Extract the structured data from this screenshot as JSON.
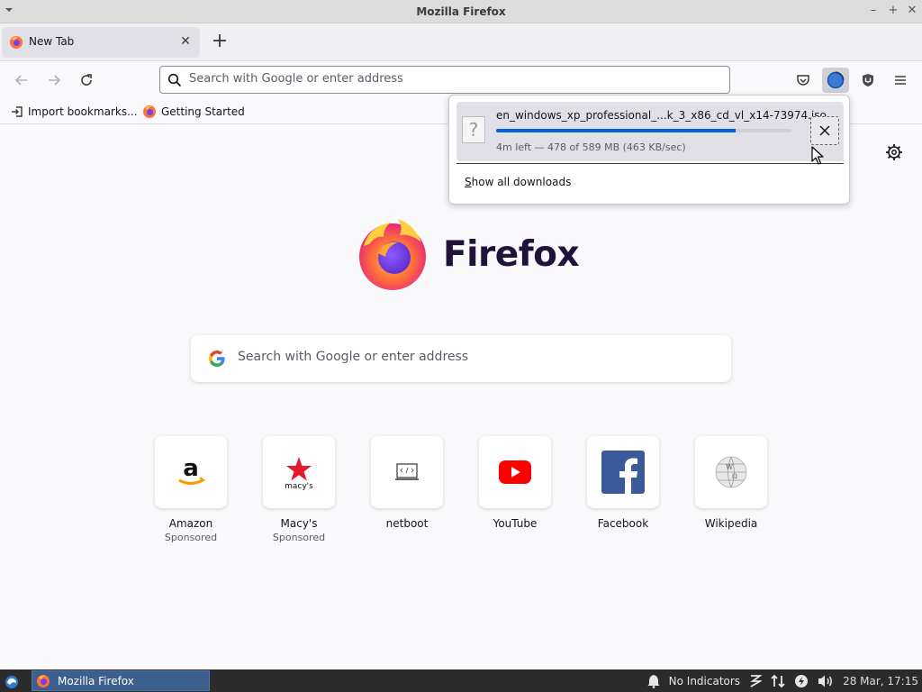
{
  "window": {
    "title": "Mozilla Firefox"
  },
  "tabs": [
    {
      "label": "New Tab",
      "active": true
    }
  ],
  "urlbar": {
    "placeholder": "Search with Google or enter address"
  },
  "bookmarks": [
    {
      "label": "Import bookmarks...",
      "icon": "import-icon"
    },
    {
      "label": "Getting Started",
      "icon": "firefox-icon"
    }
  ],
  "downloads": {
    "filename": "en_windows_xp_professional_...k_3_x86_cd_vl_x14-73974.iso",
    "status": "4m left — 478 of 589 MB (463 KB/sec)",
    "progress": 0.81,
    "show_all": "Show all downloads",
    "show_all_accesskey": "S",
    "show_all_rest": "how all downloads"
  },
  "newtab": {
    "logo_text": "Firefox",
    "search_placeholder": "Search with Google or enter address",
    "top_sites": [
      {
        "name": "Amazon",
        "sponsor": "Sponsored",
        "icon": "amazon-icon"
      },
      {
        "name": "Macy's",
        "sponsor": "Sponsored",
        "icon": "macys-icon"
      },
      {
        "name": "netboot",
        "sponsor": "",
        "icon": "netboot-icon"
      },
      {
        "name": "YouTube",
        "sponsor": "",
        "icon": "youtube-icon"
      },
      {
        "name": "Facebook",
        "sponsor": "",
        "icon": "facebook-icon"
      },
      {
        "name": "Wikipedia",
        "sponsor": "",
        "icon": "wikipedia-icon"
      }
    ],
    "macys_logo_text": "macy's"
  },
  "taskbar": {
    "task_label": "Mozilla Firefox",
    "indicators": "No Indicators",
    "clock": "28 Mar, 17:15"
  },
  "colors": {
    "accent": "#0060df",
    "taskbar": "#2b2b2b",
    "youtube": "#ff0000",
    "facebook": "#1877f2",
    "macys": "#e21a2c"
  }
}
